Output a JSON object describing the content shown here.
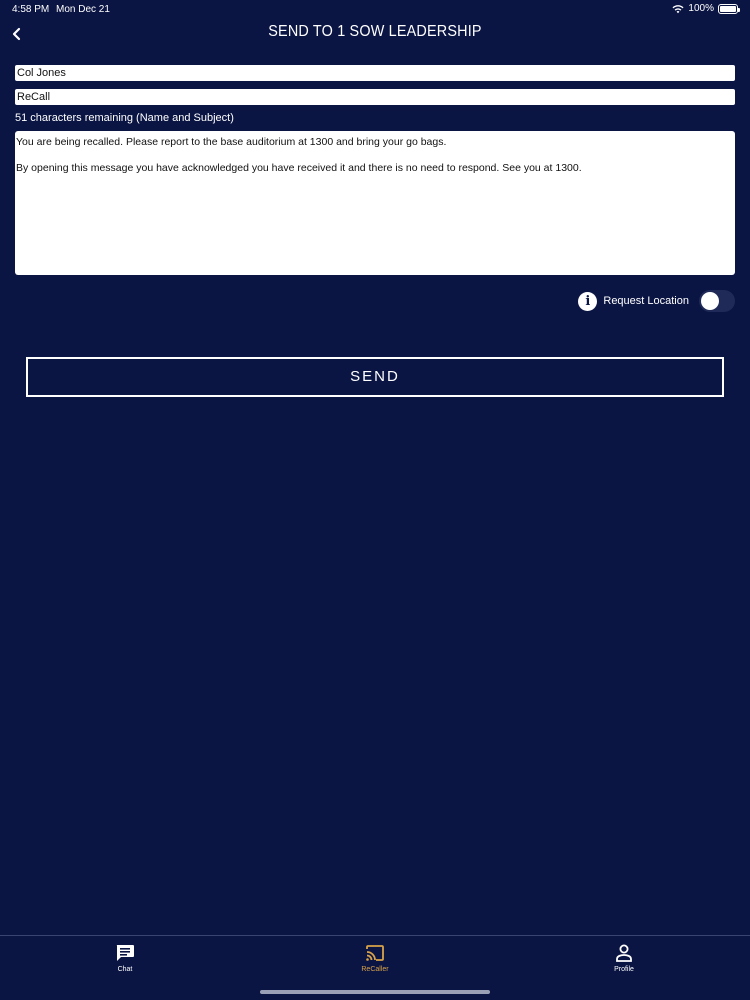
{
  "status_bar": {
    "time": "4:58 PM",
    "date": "Mon Dec 21",
    "battery": "100%",
    "battery_level": 1.0
  },
  "header": {
    "title": "SEND TO 1 SOW LEADERSHIP",
    "back_icon": "chevron-left-icon"
  },
  "form": {
    "name_value": "Col Jones",
    "subject_value": "ReCall",
    "char_remaining": "51 characters remaining (Name and Subject)",
    "message": "You are being recalled. Please report to the base auditorium at 1300 and bring your go bags.\n\nBy opening this message you have acknowledged you have received it and there is no need to respond. See you at 1300.",
    "request_location_label": "Request Location",
    "request_location_on": false,
    "send_label": "SEND"
  },
  "tabs": [
    {
      "label": "Chat",
      "icon": "chat-icon",
      "active": false
    },
    {
      "label": "ReCaller",
      "icon": "cast-icon",
      "active": true
    },
    {
      "label": "Profile",
      "icon": "person-icon",
      "active": false
    }
  ],
  "colors": {
    "background": "#0b1543",
    "accent": "#d8a34a",
    "text": "#ffffff"
  }
}
